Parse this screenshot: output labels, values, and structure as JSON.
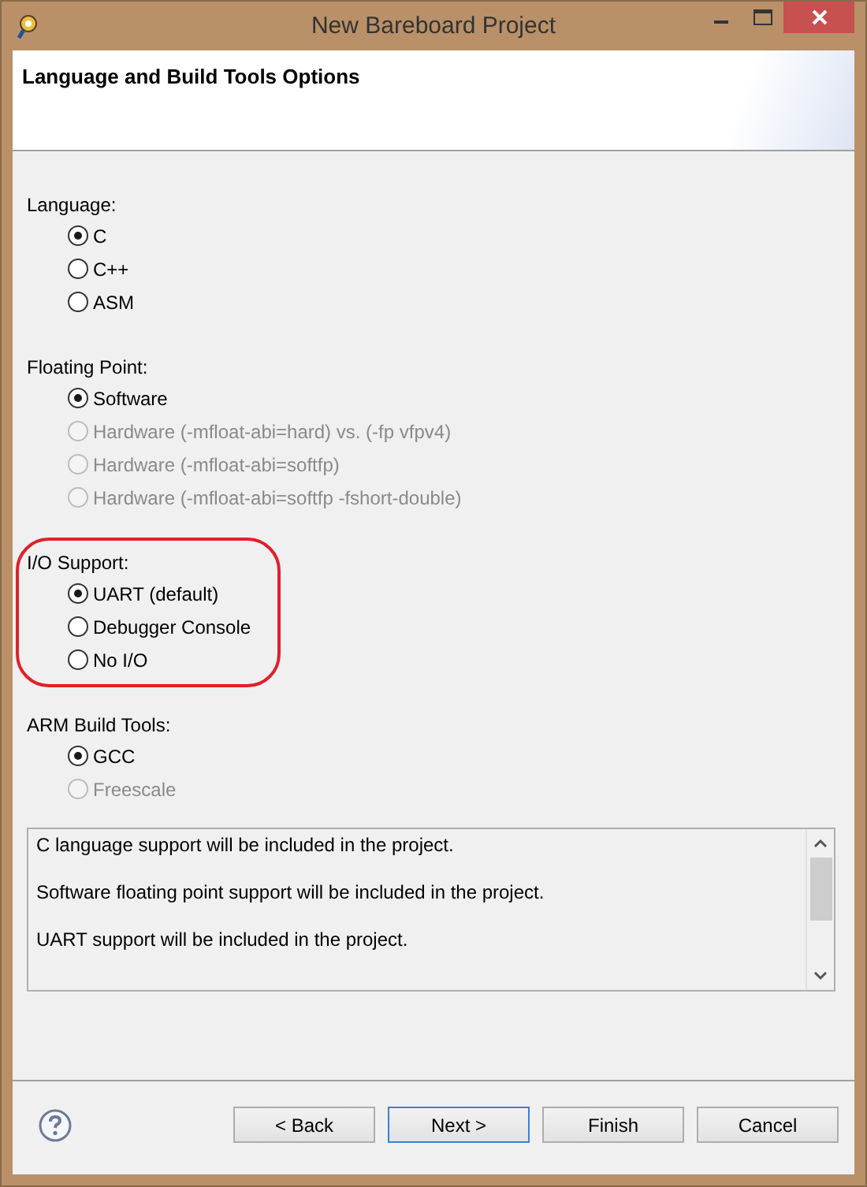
{
  "window": {
    "title": "New Bareboard Project"
  },
  "header": {
    "title": "Language and Build Tools Options"
  },
  "groups": [
    {
      "label": "Language:",
      "highlighted": false,
      "options": [
        {
          "label": "C",
          "selected": true,
          "disabled": false
        },
        {
          "label": "C++",
          "selected": false,
          "disabled": false
        },
        {
          "label": "ASM",
          "selected": false,
          "disabled": false
        }
      ]
    },
    {
      "label": "Floating Point:",
      "highlighted": false,
      "options": [
        {
          "label": "Software",
          "selected": true,
          "disabled": false
        },
        {
          "label": "Hardware (-mfloat-abi=hard) vs. (-fp vfpv4)",
          "selected": false,
          "disabled": true
        },
        {
          "label": "Hardware (-mfloat-abi=softfp)",
          "selected": false,
          "disabled": true
        },
        {
          "label": "Hardware (-mfloat-abi=softfp -fshort-double)",
          "selected": false,
          "disabled": true
        }
      ]
    },
    {
      "label": "I/O Support:",
      "highlighted": true,
      "options": [
        {
          "label": "UART (default)",
          "selected": true,
          "disabled": false
        },
        {
          "label": "Debugger Console",
          "selected": false,
          "disabled": false
        },
        {
          "label": "No I/O",
          "selected": false,
          "disabled": false
        }
      ]
    },
    {
      "label": "ARM Build Tools:",
      "highlighted": false,
      "options": [
        {
          "label": "GCC",
          "selected": true,
          "disabled": false
        },
        {
          "label": "Freescale",
          "selected": false,
          "disabled": true
        }
      ]
    }
  ],
  "description": [
    "C language support will be included in the project.",
    "Software floating point support will be included in the project.",
    "UART support will be included in the project."
  ],
  "buttons": [
    {
      "label": "< Back",
      "default": false
    },
    {
      "label": "Next >",
      "default": true
    },
    {
      "label": "Finish",
      "default": false
    },
    {
      "label": "Cancel",
      "default": false
    }
  ]
}
